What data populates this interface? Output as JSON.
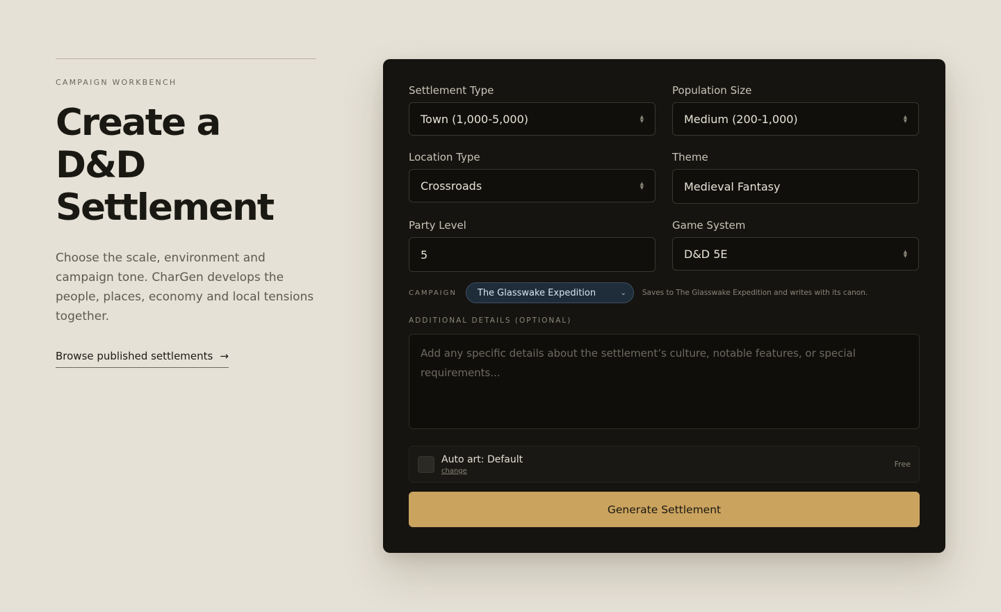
{
  "intro": {
    "eyebrow": "CAMPAIGN WORKBENCH",
    "title": "Create a D&D Settlement",
    "description": "Choose the scale, environment and campaign tone. CharGen develops the people, places, economy and local tensions together.",
    "browse_link": "Browse published settlements",
    "browse_icon": "arrow-right-icon"
  },
  "form": {
    "settlement_type": {
      "label": "Settlement Type",
      "value": "Town (1,000-5,000)"
    },
    "population_size": {
      "label": "Population Size",
      "value": "Medium (200-1,000)"
    },
    "location_type": {
      "label": "Location Type",
      "value": "Crossroads"
    },
    "theme": {
      "label": "Theme",
      "value": "Medieval Fantasy"
    },
    "party_level": {
      "label": "Party Level",
      "value": "5"
    },
    "game_system": {
      "label": "Game System",
      "value": "D&D 5E"
    },
    "campaign": {
      "label": "CAMPAIGN",
      "value": "The Glasswake Expedition",
      "note": "Saves to The Glasswake Expedition and writes with its canon."
    },
    "additional_details": {
      "label": "ADDITIONAL DETAILS (OPTIONAL)",
      "placeholder": "Add any specific details about the settlement’s culture, notable features, or special requirements..."
    },
    "auto_art": {
      "title": "Auto art: Default",
      "change": "change",
      "price": "Free",
      "checked": false
    },
    "submit": "Generate Settlement"
  },
  "colors": {
    "page_bg": "#e5e1d6",
    "card_bg": "#161410",
    "accent": "#caa35f",
    "campaign_pill": "#1f2d3a"
  }
}
